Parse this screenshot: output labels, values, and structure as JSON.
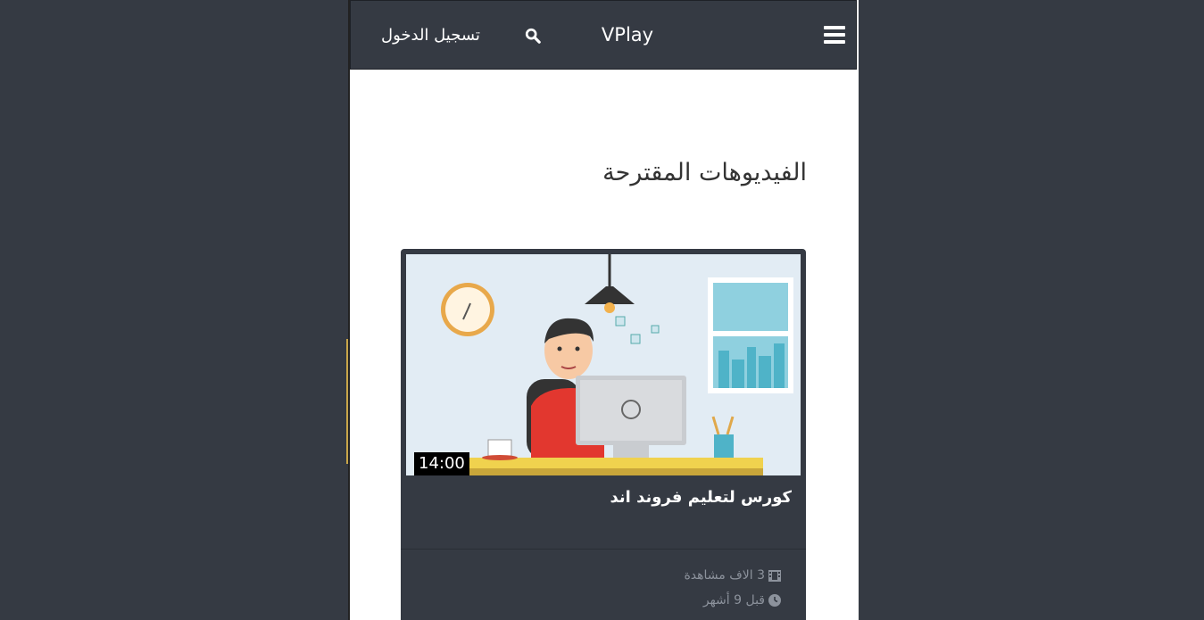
{
  "navbar": {
    "brand": "VPlay",
    "login_label": "تسجيل الدخول",
    "search_icon": "search-icon",
    "menu_icon": "hamburger-menu-icon"
  },
  "main": {
    "section_title": "الفيديوهات المقترحة",
    "videos": [
      {
        "title": "كورس لتعليم فروند اند",
        "duration": "14:00",
        "views": "3 الاف مشاهدة",
        "date": "قبل 9 أشهر"
      }
    ]
  },
  "colors": {
    "background": "#353a43",
    "navbar": "#353a43",
    "card": "#353a43",
    "meta_text": "#8c929c"
  }
}
